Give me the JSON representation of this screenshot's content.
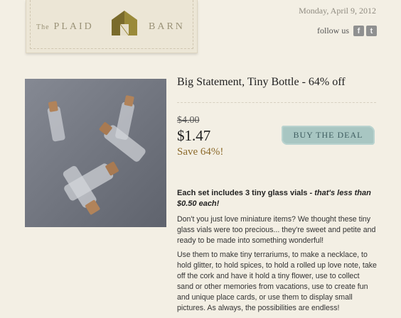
{
  "header": {
    "logo": {
      "the": "The",
      "left_word": "PLAID",
      "right_word": "BARN"
    },
    "date": "Monday, April 9, 2012",
    "follow_label": "follow us",
    "social": {
      "facebook": "f",
      "twitter": "t"
    }
  },
  "deal": {
    "title": "Big Statement, Tiny Bottle - 64% off",
    "original_price": "$4.00",
    "price": "$1.47",
    "savings": "Save 64%!",
    "buy_label": "BUY THE DEAL",
    "lead_text": "Each set includes 3 tiny glass vials - ",
    "lead_emphasis": "that's less than $0.50 each!",
    "paragraph_1": "Don't you just love miniature items?  We thought these tiny glass vials were too precious... they're sweet and petite and ready to be made into something wonderful!",
    "paragraph_2": "Use them to make tiny terrariums, to make a necklace, to hold glitter, to hold spices, to hold a rolled up love note, take off the cork and have it hold a tiny flower, use to collect sand or other memories from vacations, use to create fun and unique place cards, or use them to display small pictures.  As always, the possibilities are endless!"
  },
  "icons": [
    "barn-icon",
    "facebook-icon",
    "twitter-icon"
  ],
  "colors": {
    "background": "#f3efe4",
    "buy_button": "#a8c6c2",
    "savings": "#8c6a2a"
  }
}
